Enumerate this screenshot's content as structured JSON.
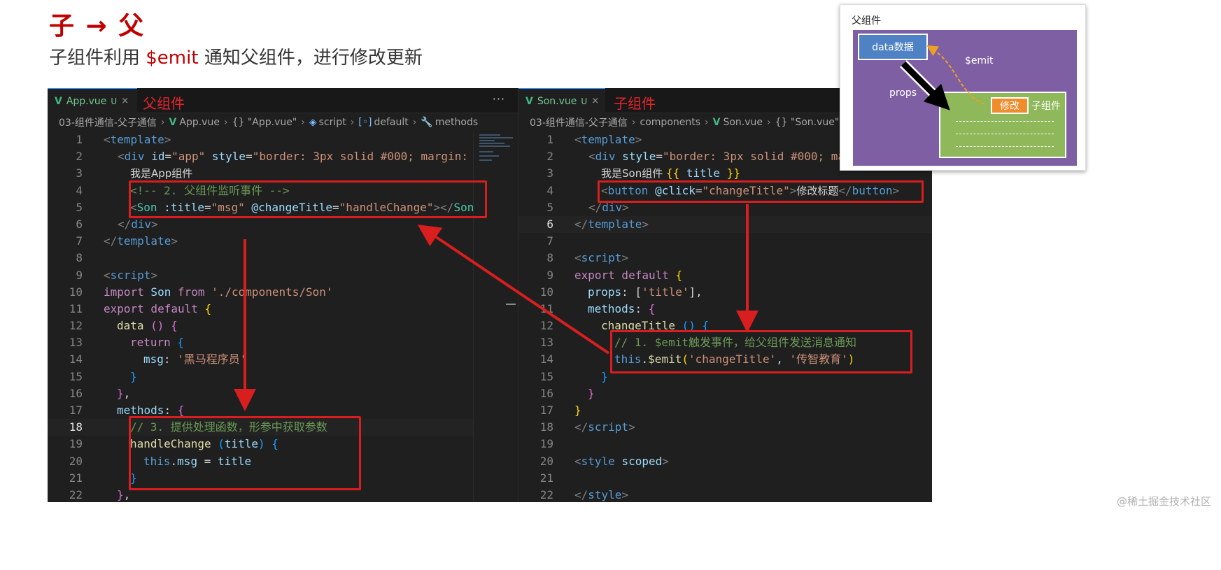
{
  "slide": {
    "title": "子 → 父",
    "subtitle_pre": "子组件利用 ",
    "subtitle_hl": "$emit",
    "subtitle_post": " 通知父组件，进行修改更新"
  },
  "left_pane": {
    "tab": {
      "icon": "V",
      "name": "App.vue",
      "status": "U",
      "close": "×"
    },
    "tab_note": "父组件",
    "more": "···",
    "breadcrumb": [
      "03-组件通信-父子通信",
      "App.vue",
      "{} \"App.vue\"",
      "script",
      "default",
      "methods"
    ],
    "line_numbers": [
      "1",
      "2",
      "3",
      "4",
      "5",
      "6",
      "7",
      "8",
      "9",
      "10",
      "11",
      "12",
      "13",
      "14",
      "15",
      "16",
      "17",
      "18",
      "19",
      "20",
      "21",
      "22"
    ],
    "active_line": "18",
    "code": {
      "l1": [
        "<",
        "template",
        ">"
      ],
      "l2": [
        "<",
        "div",
        " id",
        "=",
        "\"app\"",
        " style",
        "=",
        "\"border: 3px solid #000; margin:"
      ],
      "l3": "我是App组件",
      "l4": "<!-- 2. 父组件监听事件 -->",
      "l5": [
        "<",
        "Son",
        " :title",
        "=",
        "\"msg\"",
        " @changeTitle",
        "=",
        "\"handleChange\"",
        "></",
        "Son"
      ],
      "l6": [
        "</",
        "div",
        ">"
      ],
      "l7": [
        "</",
        "template",
        ">"
      ],
      "l9": [
        "<",
        "script",
        ">"
      ],
      "l10": [
        "import",
        " Son ",
        "from",
        " './components/Son'"
      ],
      "l11": [
        "export",
        " default",
        " {"
      ],
      "l12": [
        "data",
        " ()",
        " {"
      ],
      "l13": [
        "return",
        " {"
      ],
      "l14": [
        "msg",
        ": ",
        "'黑马程序员'"
      ],
      "l15": "}",
      "l16": [
        "}",
        ","
      ],
      "l17": [
        "methods",
        ": ",
        "{"
      ],
      "l18": "// 3. 提供处理函数，形参中获取参数",
      "l19": [
        "handleChange",
        " (",
        "title",
        ") ",
        "{"
      ],
      "l20": [
        "this",
        ".",
        "msg",
        " = ",
        "title"
      ],
      "l21": "}",
      "l22": [
        "}",
        ","
      ]
    }
  },
  "right_pane": {
    "tab": {
      "icon": "V",
      "name": "Son.vue",
      "status": "U",
      "close": "×"
    },
    "tab_note": "子组件",
    "breadcrumb": [
      "03-组件通信-父子通信",
      "components",
      "Son.vue",
      "{} \"Son.vue\""
    ],
    "line_numbers": [
      "1",
      "2",
      "3",
      "4",
      "5",
      "6",
      "7",
      "8",
      "9",
      "10",
      "11",
      "12",
      "13",
      "14",
      "15",
      "16",
      "17",
      "18",
      "19",
      "20",
      "21",
      "22"
    ],
    "active_line": "6",
    "code": {
      "l1": [
        "<",
        "template",
        ">"
      ],
      "l2": [
        "<",
        "div",
        " style",
        "=",
        "\"border: 3px solid #000; ma"
      ],
      "l3": [
        "我是Son组件 ",
        "{{",
        " title ",
        "}}"
      ],
      "l4": [
        "<",
        "button",
        " @click",
        "=",
        "\"changeTitle\"",
        ">",
        "修改标题",
        "</",
        "button",
        ">"
      ],
      "l5": [
        "</",
        "div",
        ">"
      ],
      "l6": [
        "</",
        "template",
        ">"
      ],
      "l8": [
        "<",
        "script",
        ">"
      ],
      "l9": [
        "export",
        " default",
        " {"
      ],
      "l10": [
        "props",
        ": [",
        "'title'",
        "],"
      ],
      "l11": [
        "methods",
        ": ",
        "{"
      ],
      "l12": [
        "changeTitle",
        " ()",
        " {"
      ],
      "l13": "// 1. $emit触发事件，给父组件发送消息通知",
      "l14": [
        "this",
        ".",
        "$emit",
        "(",
        "'changeTitle'",
        ", ",
        "'传智教育'",
        ")"
      ],
      "l15": "}",
      "l16": "}",
      "l17": "}",
      "l18": [
        "</",
        "script",
        ">"
      ],
      "l20": [
        "<",
        "style",
        " scoped",
        ">"
      ],
      "l22": [
        "</",
        "style",
        ">"
      ]
    }
  },
  "diagram": {
    "title": "父组件",
    "data_box": "data数据",
    "modify_box": "修改",
    "child_label": "子组件",
    "props_label": "props",
    "emit_label": "$emit",
    "colors": {
      "parent": "#7f5fa3",
      "data": "#4f82c4",
      "child": "#8fb85a",
      "modify": "#f08c2c",
      "emit_arrow": "#f0a020"
    }
  },
  "watermark": "@稀土掘金技术社区",
  "colors": {
    "accent_red": "#c00000",
    "box_red": "#d81e1e"
  }
}
